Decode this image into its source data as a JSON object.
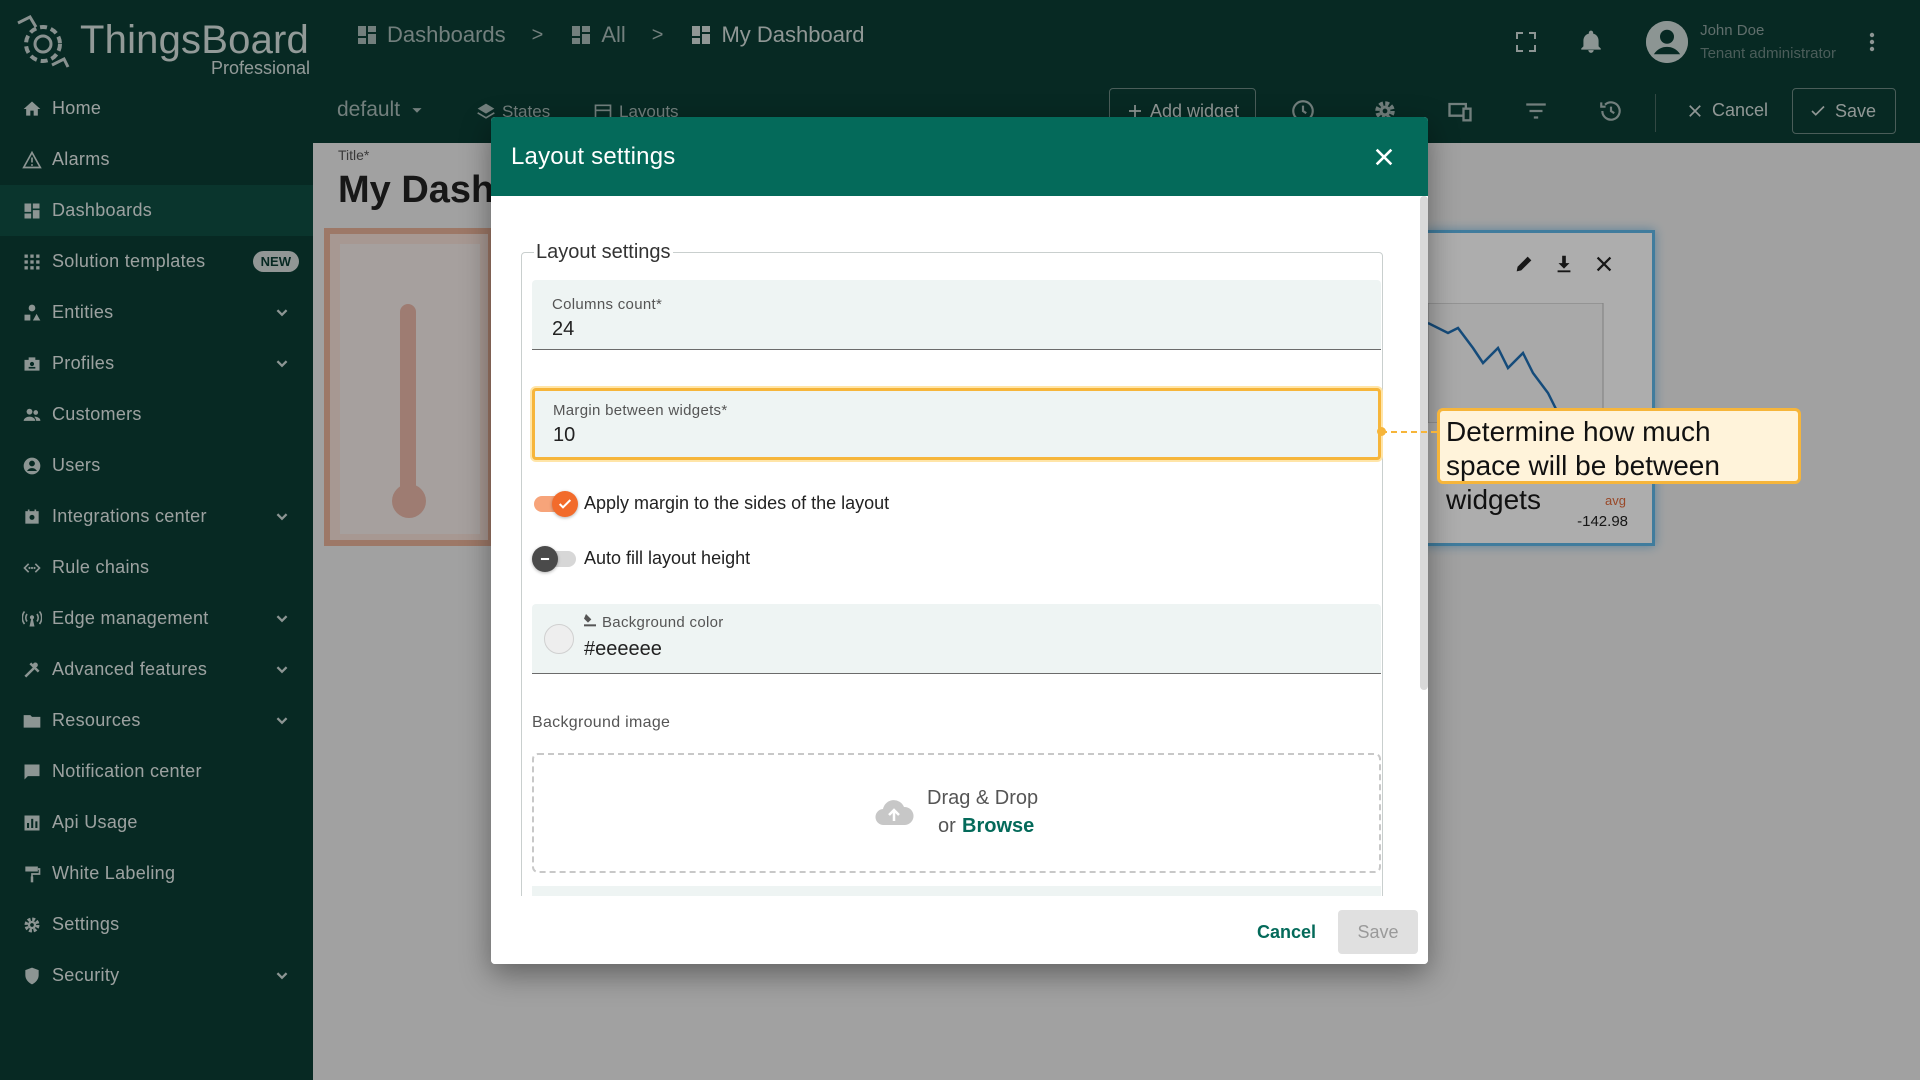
{
  "brand": {
    "name": "ThingsBoard",
    "edition": "Professional"
  },
  "sidebar": {
    "items": [
      {
        "label": "Home",
        "icon": "home-icon"
      },
      {
        "label": "Alarms",
        "icon": "alarm-icon"
      },
      {
        "label": "Dashboards",
        "icon": "dashboard-icon",
        "active": true
      },
      {
        "label": "Solution templates",
        "icon": "apps-icon",
        "badge": "NEW"
      },
      {
        "label": "Entities",
        "icon": "entities-icon",
        "expandable": true
      },
      {
        "label": "Profiles",
        "icon": "profiles-icon",
        "expandable": true
      },
      {
        "label": "Customers",
        "icon": "customers-icon"
      },
      {
        "label": "Users",
        "icon": "user-icon"
      },
      {
        "label": "Integrations center",
        "icon": "integrations-icon",
        "expandable": true
      },
      {
        "label": "Rule chains",
        "icon": "rule-chain-icon"
      },
      {
        "label": "Edge management",
        "icon": "edge-icon",
        "expandable": true
      },
      {
        "label": "Advanced features",
        "icon": "tools-icon",
        "expandable": true
      },
      {
        "label": "Resources",
        "icon": "folder-icon",
        "expandable": true
      },
      {
        "label": "Notification center",
        "icon": "notification-icon"
      },
      {
        "label": "Api Usage",
        "icon": "chart-icon"
      },
      {
        "label": "White Labeling",
        "icon": "paint-roller-icon"
      },
      {
        "label": "Settings",
        "icon": "gear-icon"
      },
      {
        "label": "Security",
        "icon": "shield-icon",
        "expandable": true
      }
    ]
  },
  "breadcrumb": {
    "items": [
      "Dashboards",
      "All",
      "My Dashboard"
    ],
    "separator": ">"
  },
  "user": {
    "name": "John Doe",
    "role": "Tenant administrator"
  },
  "toolbar": {
    "state": "default",
    "states_label": "States",
    "layouts_label": "Layouts",
    "add_widget_label": "Add widget",
    "cancel_label": "Cancel",
    "save_label": "Save"
  },
  "dashboard": {
    "title_label": "Title*",
    "title": "My Dash",
    "chart_avg_label": "avg",
    "chart_avg_value": "-142.98"
  },
  "dialog": {
    "title": "Layout settings",
    "group_legend": "Layout settings",
    "columns": {
      "label": "Columns count*",
      "value": "24"
    },
    "margin": {
      "label": "Margin between widgets*",
      "value": "10"
    },
    "apply_margin": {
      "label": "Apply margin to the sides of the layout",
      "checked": true
    },
    "auto_fill": {
      "label": "Auto fill layout height",
      "checked": false
    },
    "bg_color": {
      "label": "Background color",
      "value": "#eeeeee"
    },
    "bg_image": {
      "label": "Background image",
      "dz_text": "Drag & Drop",
      "dz_or": "or",
      "dz_browse": "Browse"
    },
    "cancel_label": "Cancel",
    "save_label": "Save"
  },
  "callout": {
    "text": "Determine how much space will be between widgets"
  },
  "colors": {
    "sidebar": "#0b3d34",
    "header": "#046a5a",
    "accent": "#f6b53a",
    "toggle_on": "#f26b2b"
  }
}
